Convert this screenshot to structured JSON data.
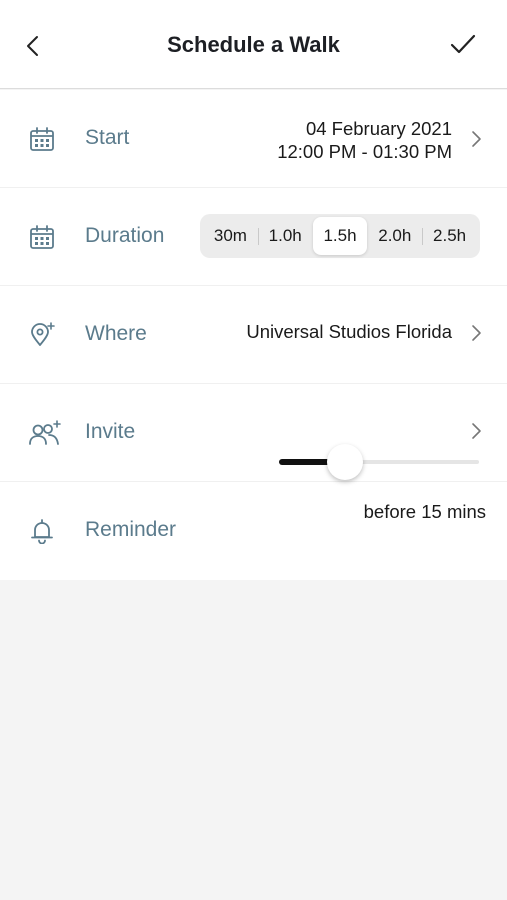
{
  "header": {
    "title": "Schedule a Walk",
    "back_icon": "chevron-left-icon",
    "confirm_icon": "checkmark-icon"
  },
  "start": {
    "label": "Start",
    "date": "04 February 2021",
    "time": "12:00 PM - 01:30 PM",
    "icon": "calendar-icon"
  },
  "duration": {
    "label": "Duration",
    "icon": "calendar-icon",
    "options": [
      "30m",
      "1.0h",
      "1.5h",
      "2.0h",
      "2.5h"
    ],
    "selected": "1.5h"
  },
  "where": {
    "label": "Where",
    "value": "Universal Studios Florida",
    "icon": "location-pin-add-icon"
  },
  "invite": {
    "label": "Invite",
    "icon": "people-add-icon"
  },
  "reminder": {
    "label": "Reminder",
    "value": "before 15 mins",
    "icon": "bell-icon",
    "slider_fraction": 0.33
  },
  "colors": {
    "label": "#5b7b8c",
    "text": "#1a1a1a",
    "background": "#f4f4f4",
    "slider_fill": "#111111"
  }
}
